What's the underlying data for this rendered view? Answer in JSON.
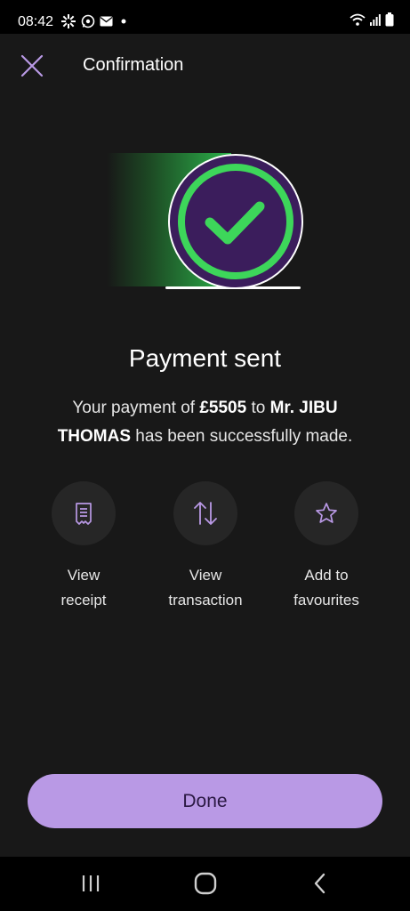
{
  "status_bar": {
    "time": "08:42",
    "left_icons": [
      "settings-notification-icon",
      "whatsapp-icon",
      "mail-icon",
      "dot-icon"
    ],
    "right_icons": [
      "wifi-icon",
      "signal-icon",
      "battery-icon"
    ]
  },
  "header": {
    "title": "Confirmation",
    "close_icon": "close-icon"
  },
  "hero": {
    "icon": "check-circle-icon",
    "colors": {
      "ring": "#3dd65a",
      "inner": "#3b1d5c",
      "trail": "#2bb24a"
    }
  },
  "main": {
    "heading": "Payment sent",
    "message_prefix": "Your payment of ",
    "amount": "£5505",
    "message_middle": " to ",
    "recipient": "Mr. JIBU THOMAS",
    "message_suffix": " has been successfully made."
  },
  "actions": [
    {
      "icon": "receipt-icon",
      "label_line1": "View",
      "label_line2": "receipt"
    },
    {
      "icon": "transfer-arrows-icon",
      "label_line1": "View",
      "label_line2": "transaction"
    },
    {
      "icon": "star-icon",
      "label_line1": "Add to",
      "label_line2": "favourites"
    }
  ],
  "footer": {
    "done_label": "Done",
    "accent": "#b999e5"
  },
  "nav_bar": {
    "buttons": [
      "recent-apps-icon",
      "home-icon",
      "back-icon"
    ]
  }
}
